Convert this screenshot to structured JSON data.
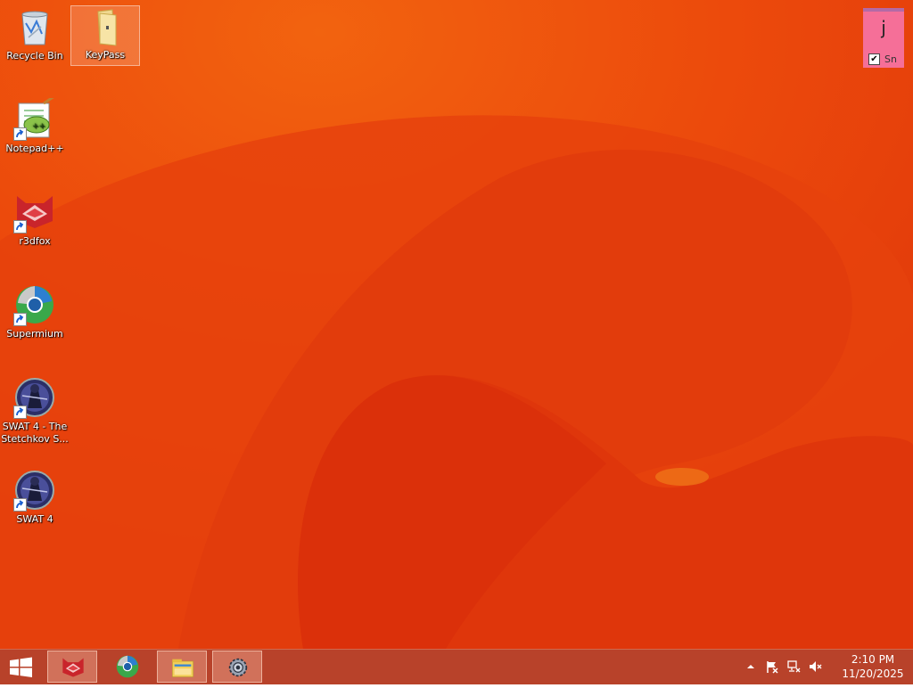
{
  "desktop": {
    "icons": [
      {
        "label": "Recycle Bin",
        "icon": "recycle-bin-icon"
      },
      {
        "label": "KeyPass",
        "icon": "folder-icon"
      },
      {
        "label": "Notepad++",
        "icon": "notepadpp-icon"
      },
      {
        "label": "r3dfox",
        "icon": "r3dfox-icon"
      },
      {
        "label": "Supermium",
        "icon": "supermium-icon"
      },
      {
        "label": "SWAT 4 - The Stetchkov S...",
        "icon": "swat4-icon"
      },
      {
        "label": "SWAT 4",
        "icon": "swat4-icon"
      }
    ]
  },
  "sticky_note": {
    "text": "j",
    "checkbox_label": "Sn",
    "checked": true
  },
  "taskbar": {
    "pinned": [
      "r3dfox",
      "Supermium",
      "File Explorer",
      "Settings"
    ],
    "clock": {
      "time": "2:10 PM",
      "date": "11/20/2025"
    },
    "tray": [
      "show-hidden-icons",
      "action-center-flag-icon",
      "network-icon",
      "volume-muted-icon"
    ]
  },
  "colors": {
    "wallpaper_base": "#e8420c",
    "taskbar": "#b8422a",
    "sticky": "#f56f98"
  }
}
